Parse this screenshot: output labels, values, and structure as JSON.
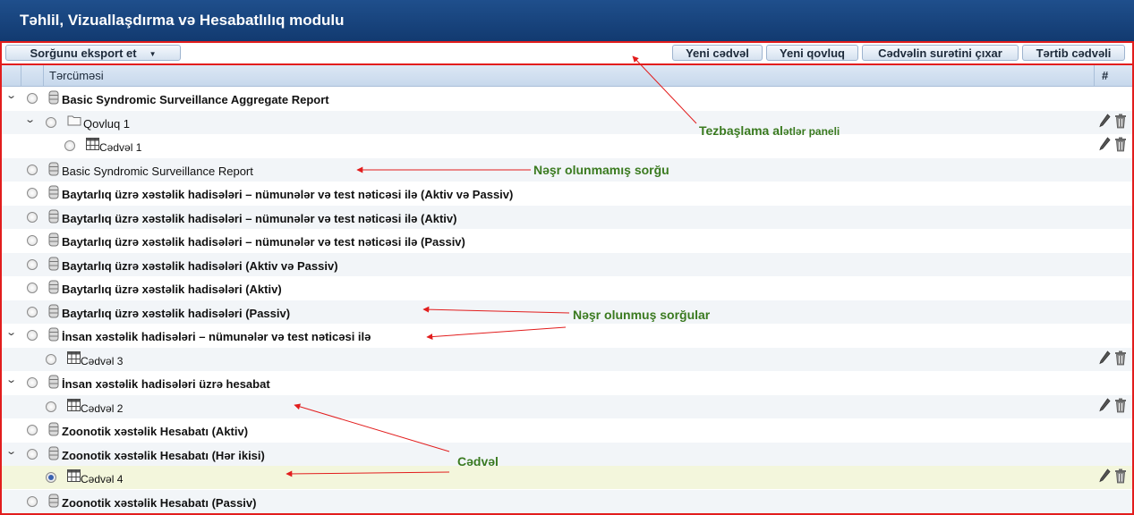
{
  "header": {
    "title": "Təhlil, Vizuallaşdırma və Hesabatlılıq modulu"
  },
  "toolbar": {
    "export_label": "Sorğunu eksport et",
    "new_table_label": "Yeni cədvəl",
    "new_folder_label": "Yeni qovluq",
    "copy_table_label": "Cədvəlin surətini çıxar",
    "edit_table_label": "Tərtib cədvəli"
  },
  "grid": {
    "columns": {
      "name": "Tərcüməsi",
      "actions": "#"
    },
    "rows": [
      {
        "label": "Basic Syndromic Surveillance Aggregate Report",
        "kind": "query",
        "bold": true,
        "chevron": true,
        "level": 0
      },
      {
        "label": "Qovluq 1",
        "kind": "folder",
        "bold": false,
        "chevron": true,
        "level": 1,
        "actions": true
      },
      {
        "label": "Cədvəl 1",
        "kind": "table",
        "bold": false,
        "level": 2,
        "actions": true
      },
      {
        "label": "Basic Syndromic Surveillance Report",
        "kind": "query",
        "bold": false,
        "level": 0
      },
      {
        "label": "Baytarlıq üzrə xəstəlik hadisələri – nümunələr və test nəticəsi ilə (Aktiv və Passiv)",
        "kind": "query",
        "bold": true,
        "level": 0
      },
      {
        "label": "Baytarlıq üzrə xəstəlik hadisələri – nümunələr və test nəticəsi ilə (Aktiv)",
        "kind": "query",
        "bold": true,
        "level": 0
      },
      {
        "label": "Baytarlıq üzrə xəstəlik hadisələri – nümunələr və test nəticəsi ilə (Passiv)",
        "kind": "query",
        "bold": true,
        "level": 0
      },
      {
        "label": "Baytarlıq üzrə xəstəlik hadisələri (Aktiv və Passiv)",
        "kind": "query",
        "bold": true,
        "level": 0
      },
      {
        "label": "Baytarlıq üzrə xəstəlik hadisələri (Aktiv)",
        "kind": "query",
        "bold": true,
        "level": 0
      },
      {
        "label": "Baytarlıq üzrə xəstəlik hadisələri (Passiv)",
        "kind": "query",
        "bold": true,
        "level": 0
      },
      {
        "label": "İnsan xəstəlik hadisələri – nümunələr və test nəticəsi ilə",
        "kind": "query",
        "bold": true,
        "chevron": true,
        "level": 0
      },
      {
        "label": "Cədvəl 3",
        "kind": "table",
        "bold": false,
        "level": 1,
        "actions": true
      },
      {
        "label": "İnsan xəstəlik hadisələri üzrə hesabat",
        "kind": "query",
        "bold": true,
        "chevron": true,
        "level": 0
      },
      {
        "label": "Cədvəl 2",
        "kind": "table",
        "bold": false,
        "level": 1,
        "actions": true
      },
      {
        "label": "Zoonotik xəstəlik Hesabatı (Aktiv)",
        "kind": "query",
        "bold": true,
        "level": 0
      },
      {
        "label": "Zoonotik xəstəlik Hesabatı (Hər ikisi)",
        "kind": "query",
        "bold": true,
        "chevron": true,
        "level": 0
      },
      {
        "label": "Cədvəl 4",
        "kind": "table",
        "bold": false,
        "level": 1,
        "actions": true,
        "selected": true
      },
      {
        "label": "Zoonotik xəstəlik Hesabatı (Passiv)",
        "kind": "query",
        "bold": true,
        "level": 0
      }
    ]
  },
  "annotations": {
    "toolbar_panel_main": "Tezbaşlama al",
    "toolbar_panel_rest": "ətlər paneli",
    "unpublished": "Nəşr olunmamış sorğu",
    "published": "Nəşr olunmuş sorğular",
    "table": "Cədvəl"
  },
  "colors": {
    "header": "#1a4a85",
    "annotation_border": "#e21d1d",
    "annotation_text": "#3a7a1f",
    "selected_row": "#f3f6dc"
  },
  "icons": {
    "query": "database-icon",
    "folder": "folder-icon",
    "table": "table-grid-icon",
    "edit": "pencil-icon",
    "delete": "trash-icon",
    "expand": "chevron-down-icon"
  }
}
